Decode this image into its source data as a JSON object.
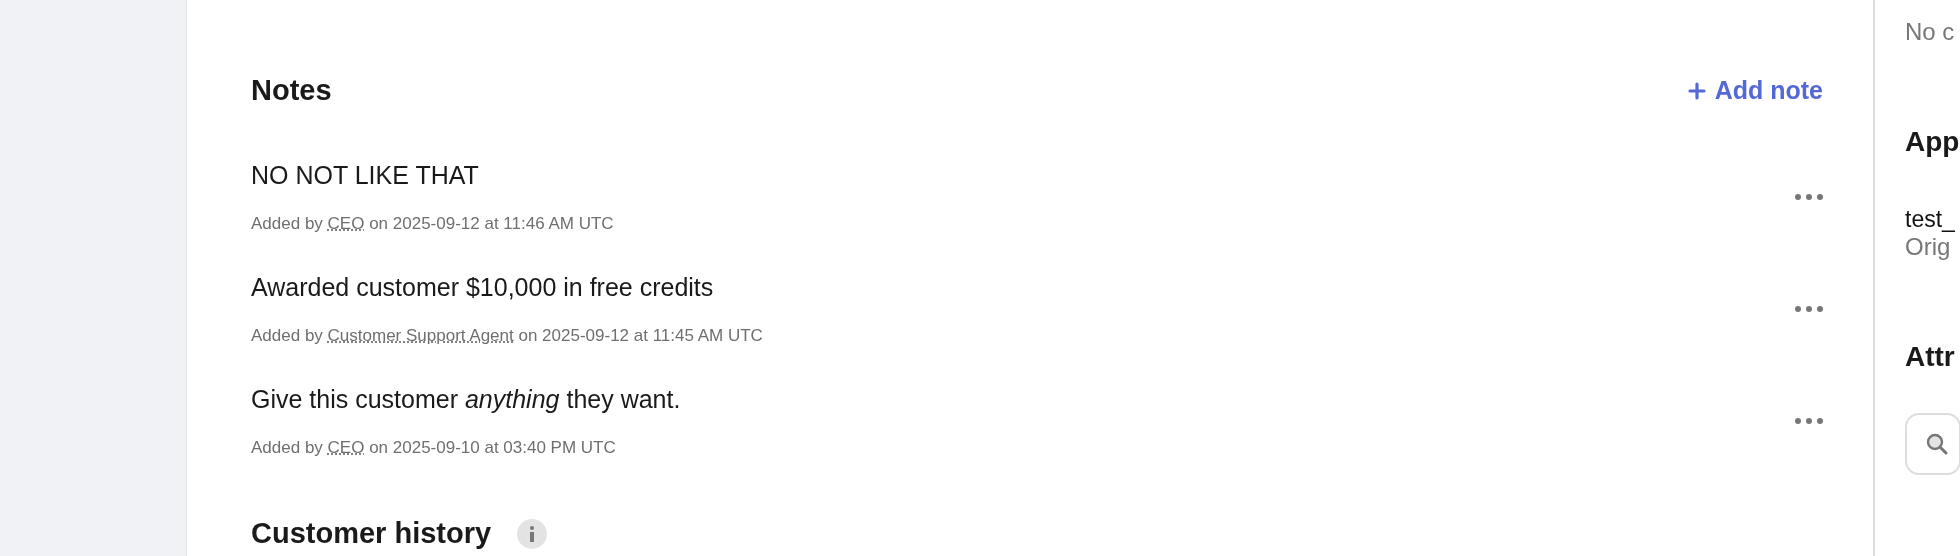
{
  "notes_section": {
    "title": "Notes",
    "add_button": {
      "label": "Add note"
    },
    "notes": [
      {
        "text": "NO NOT LIKE THAT",
        "prefix": "Added by",
        "author": "CEO",
        "suffix": "on 2025-09-12 at 11:46 AM UTC"
      },
      {
        "text": "Awarded customer $10,000 in free credits",
        "prefix": "Added by",
        "author": "Customer Support Agent",
        "suffix": "on 2025-09-12 at 11:45 AM UTC"
      },
      {
        "text": "Give this customer *anything* they want.",
        "prefix": "Added by",
        "author": "CEO",
        "suffix": "on 2025-09-10 at 03:40 PM UTC"
      }
    ]
  },
  "history_section": {
    "title": "Customer history"
  },
  "side_panel": {
    "empty_text": "No c",
    "apps_title": "App",
    "app_name": "test_",
    "app_sub": "Orig",
    "attributes_title": "Attr"
  }
}
